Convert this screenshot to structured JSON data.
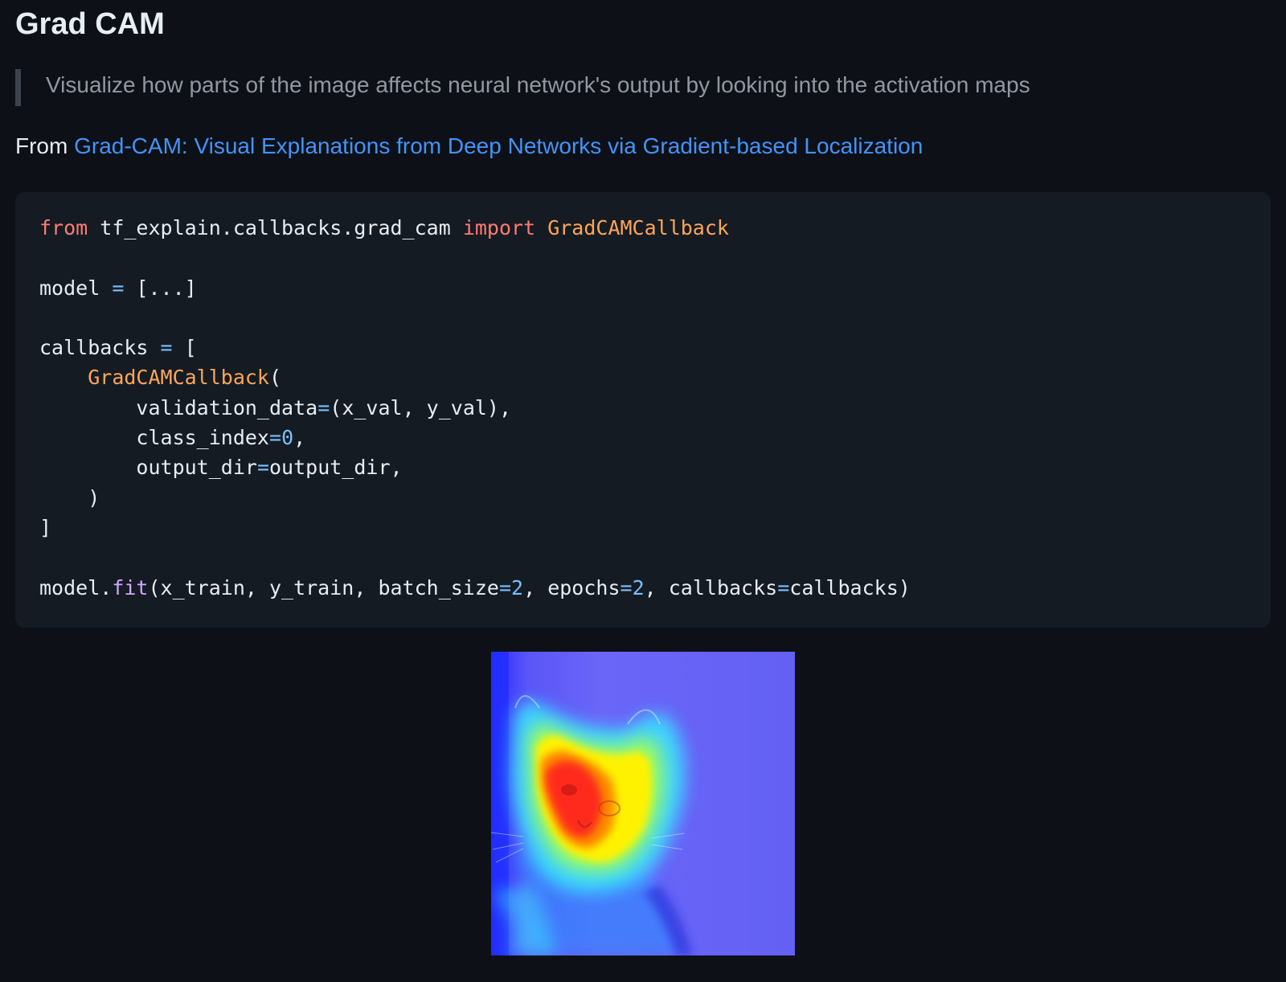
{
  "section": {
    "title": "Grad CAM",
    "description": "Visualize how parts of the image affects neural network's output by looking into the activation maps",
    "source_prefix": "From",
    "source_link_text": "Grad-CAM: Visual Explanations from Deep Networks via Gradient-based Localization"
  },
  "code": {
    "language": "python",
    "tokens": {
      "from": "from",
      "module": " tf_explain.callbacks.grad_cam ",
      "import": "import",
      "class_name": "GradCAMCallback",
      "model_var": "model ",
      "eq": "=",
      "model_value": " [...]",
      "callbacks_var": "callbacks ",
      "open_bracket": " [",
      "indent1": "    ",
      "open_paren": "(",
      "indent2": "        ",
      "validation_arg": "validation_data",
      "validation_val": "(x_val, y_val),",
      "class_index_arg": "class_index",
      "class_index_val": "0",
      "comma": ",",
      "output_dir_arg": "output_dir",
      "output_dir_val": "output_dir,",
      "close_paren": ")",
      "close_bracket": "]",
      "model_dot": "model.",
      "fit": "fit",
      "fit_args_1": "(x_train, y_train, batch_size",
      "batch_size_val": "2",
      "fit_args_2": ", epochs",
      "epochs_val": "2",
      "fit_args_3": ", callbacks",
      "fit_args_4": "callbacks)"
    }
  },
  "figure": {
    "image": "grad-cam-heatmap-cat",
    "colors": {
      "background_blue": "#5f5cf6",
      "deep_blue": "#1f3cff",
      "cyan": "#39e6ff",
      "yellow": "#fff200",
      "orange": "#ff8a00",
      "red": "#ff2a1a"
    }
  },
  "theme": {
    "page_bg": "#0d1117",
    "code_bg": "#151b23",
    "text": "#e6edf3",
    "muted": "#9198a1",
    "link": "#4493f8",
    "keyword": "#ff7b72",
    "class": "#ffa657",
    "number": "#79c0ff",
    "function": "#d2a8ff"
  }
}
